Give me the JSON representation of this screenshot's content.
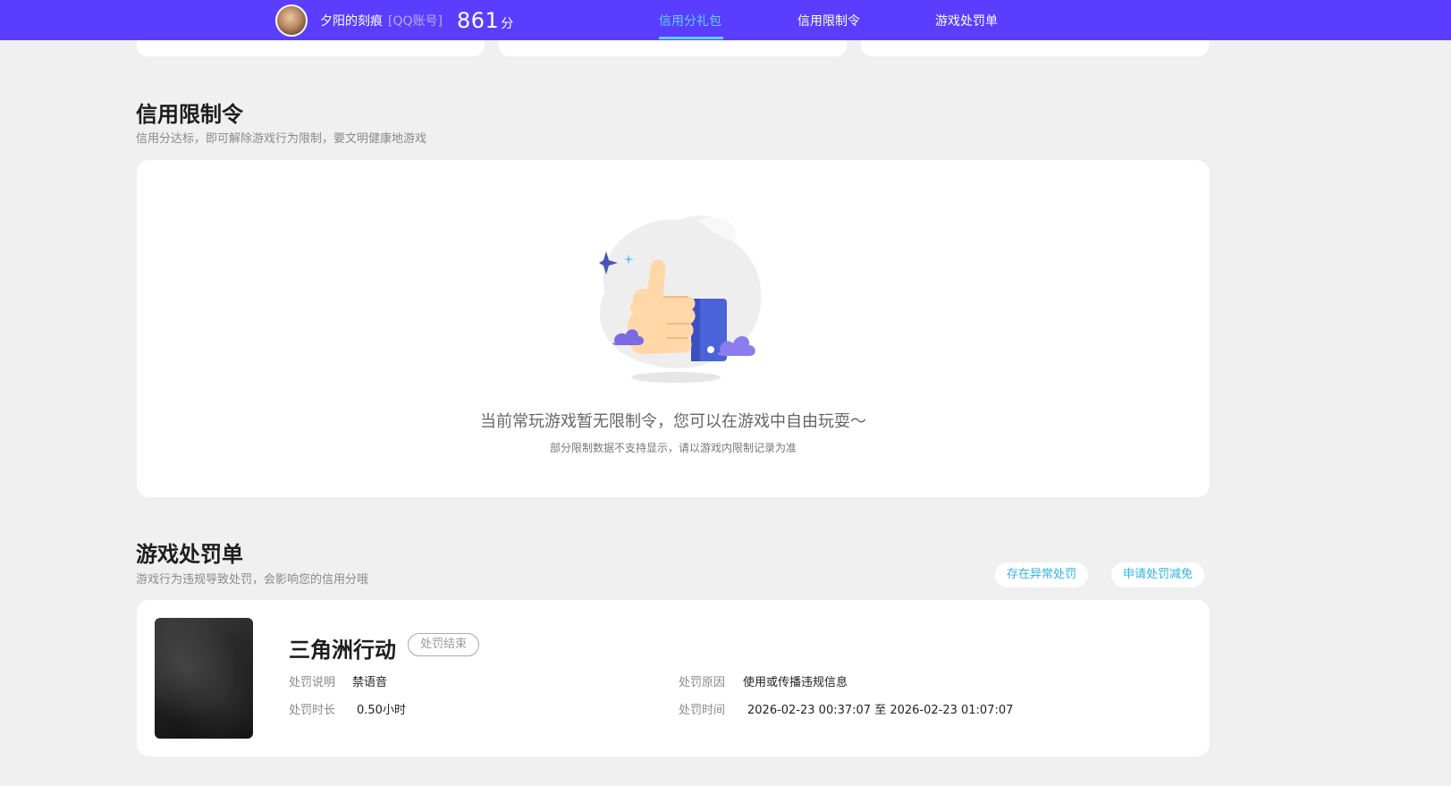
{
  "header": {
    "username": "夕阳的刻痕",
    "account_type": "[QQ账号]",
    "score": "861",
    "score_unit": "分",
    "nav": [
      {
        "label": "信用分礼包",
        "active": true
      },
      {
        "label": "信用限制令",
        "active": false
      },
      {
        "label": "游戏处罚单",
        "active": false
      }
    ],
    "colors": {
      "bar": "#5b3dff",
      "active": "#5fd1ff"
    }
  },
  "restriction": {
    "title": "信用限制令",
    "subtitle": "信用分达标，即可解除游戏行为限制，要文明健康地游戏",
    "empty_message": "当前常玩游戏暂无限制令，您可以在游戏中自由玩耍～",
    "empty_note": "部分限制数据不支持显示，请以游戏内限制记录为准",
    "illustration_icon": "thumbs-up-icon"
  },
  "penalty": {
    "title": "游戏处罚单",
    "subtitle": "游戏行为违规导致处罚，会影响您的信用分哦",
    "buttons": {
      "abnormal": "存在异常处罚",
      "appeal": "申请处罚减免"
    },
    "items": [
      {
        "game": "三角洲行动",
        "status": "处罚结束",
        "desc_label": "处罚说明",
        "desc_value": "禁语音",
        "reason_label": "处罚原因",
        "reason_value": "使用或传播违规信息",
        "duration_label": "处罚时长",
        "duration_value": "0.50小时",
        "time_label": "处罚时间",
        "time_value": "2026-02-23 00:37:07 至 2026-02-23 01:07:07"
      }
    ]
  }
}
